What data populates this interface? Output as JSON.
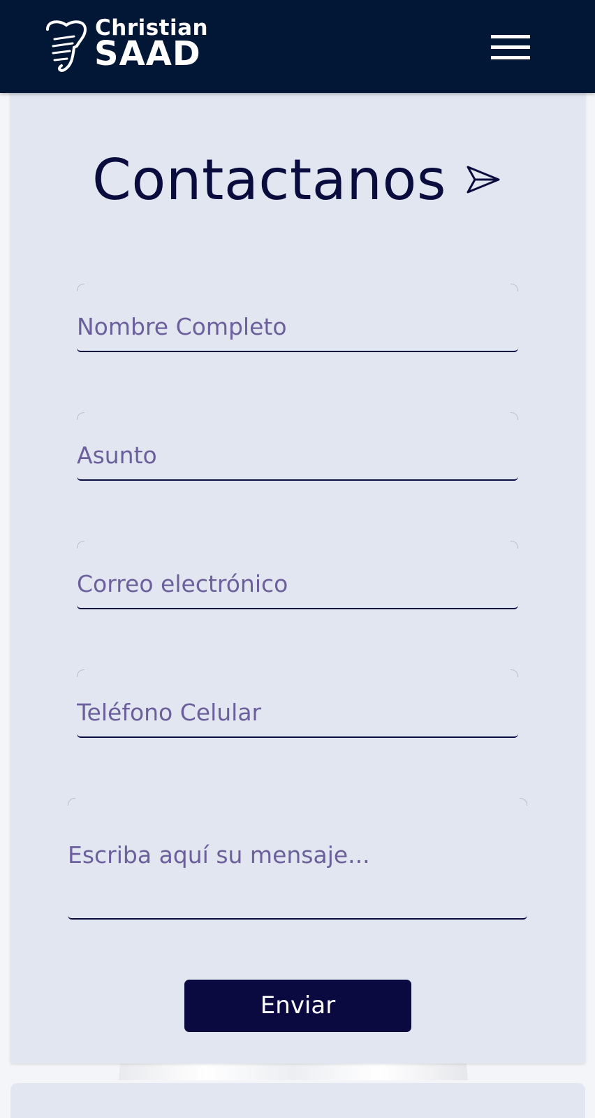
{
  "header": {
    "brand_first": "Christian",
    "brand_last": "SAAD",
    "menu_icon": "hamburger-menu-icon",
    "background_color": "#021635"
  },
  "contact": {
    "title": "Contactanos",
    "title_icon": "paper-plane-icon",
    "fields": {
      "name_placeholder": "Nombre Completo",
      "subject_placeholder": "Asunto",
      "email_placeholder": "Correo electrónico",
      "phone_placeholder": "Teléfono Celular",
      "message_placeholder": "Escriba aquí su mensaje..."
    },
    "submit_label": "Enviar",
    "card_color": "#e1e6f0",
    "accent_color": "#0a0940"
  }
}
